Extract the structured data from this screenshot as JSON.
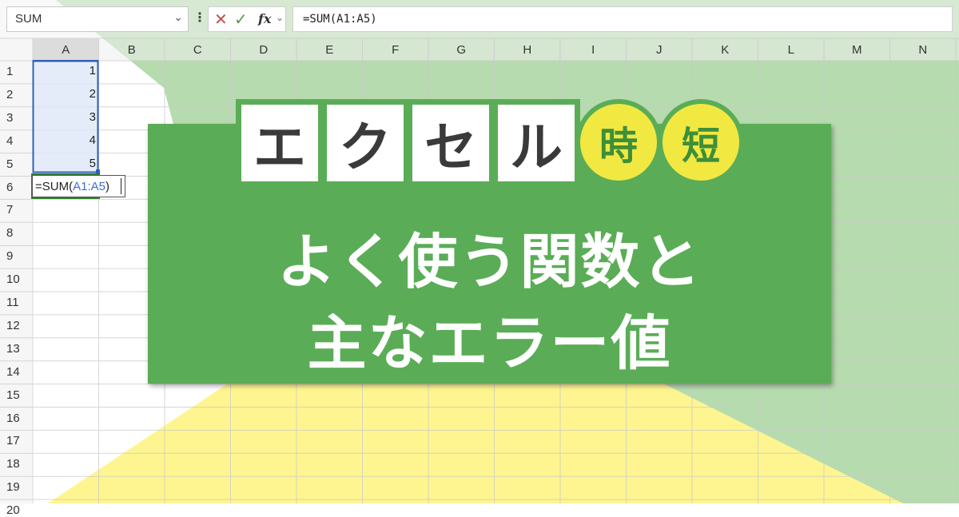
{
  "formula_bar": {
    "name_box": "SUM",
    "formula": "=SUM(A1:A5)",
    "fx_label": "fx",
    "cancel_glyph": "✕",
    "enter_glyph": "✓",
    "chevron_glyph": "⌄",
    "kebab_glyph": "⋮"
  },
  "columns": [
    "A",
    "B",
    "C",
    "D",
    "E",
    "F",
    "G",
    "H",
    "I",
    "J",
    "K",
    "L",
    "M",
    "N"
  ],
  "rows": [
    "1",
    "2",
    "3",
    "4",
    "5",
    "6",
    "7",
    "8",
    "9",
    "10",
    "11",
    "12",
    "13",
    "14",
    "15",
    "16",
    "17",
    "18",
    "19",
    "20"
  ],
  "cells": {
    "A1": "1",
    "A2": "2",
    "A3": "3",
    "A4": "4",
    "A5": "5",
    "A6_prefix": "=SUM(",
    "A6_ref": "A1:A5",
    "A6_suffix": ")"
  },
  "banner": {
    "brand_tiles": [
      "エ",
      "ク",
      "セ",
      "ル"
    ],
    "brand_badges": [
      "時",
      "短"
    ],
    "title_line1": "よく使う関数と",
    "title_line2": "主なエラー値"
  },
  "colors": {
    "green_bg": "#a9d5a0",
    "yellow_bg": "#fff48a",
    "card_green": "#5aad56",
    "badge_yellow": "#f2e842",
    "selection_blue": "#2f5fb5",
    "active_cell_border": "#2e7d32"
  }
}
